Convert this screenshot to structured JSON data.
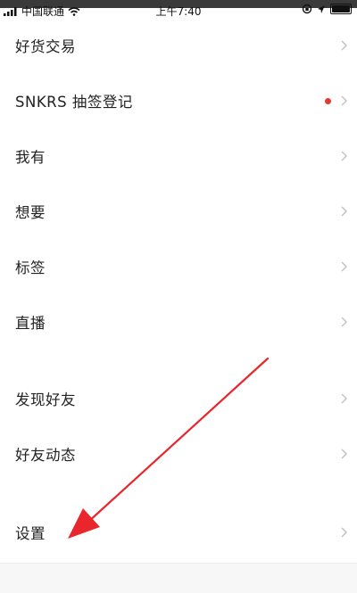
{
  "status_bar": {
    "carrier": "中国联通",
    "time": "上午7:40",
    "icons": [
      "signal-icon",
      "wifi-icon",
      "lock-rotation-icon",
      "location-icon",
      "battery-icon"
    ]
  },
  "menu": {
    "items": [
      {
        "label": "好货交易",
        "badge": false
      },
      {
        "label": "SNKRS 抽签登记",
        "badge": true
      },
      {
        "label": "我有",
        "badge": false
      },
      {
        "label": "想要",
        "badge": false
      },
      {
        "label": "标签",
        "badge": false
      },
      {
        "label": "直播",
        "badge": false
      },
      {
        "label": "发现好友",
        "badge": false
      },
      {
        "label": "好友动态",
        "badge": false
      },
      {
        "label": "设置",
        "badge": false
      }
    ]
  },
  "colors": {
    "badge": "#e03b30",
    "annotation_arrow": "#e8262b",
    "chevron": "#c4c4c4"
  }
}
